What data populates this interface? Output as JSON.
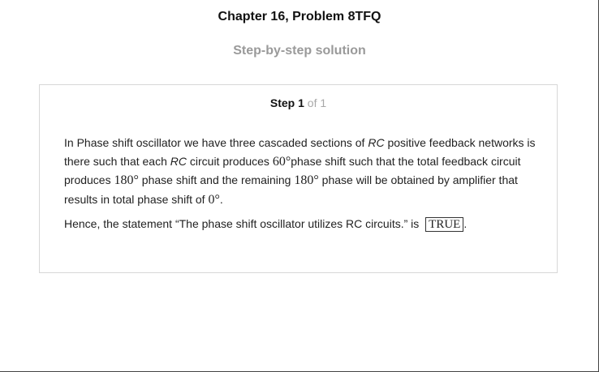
{
  "header": {
    "title": "Chapter 16, Problem 8TFQ",
    "subtitle": "Step-by-step solution"
  },
  "step": {
    "label": "Step",
    "number": "1",
    "of_text": "of 1"
  },
  "body": {
    "p1": {
      "t1": "In Phase shift oscillator we have three cascaded sections of ",
      "rc1": "RC",
      "t2": " positive feedback networks is there such that each ",
      "rc2": "RC",
      "t3": " circuit produces ",
      "m1": "60°",
      "t4": "phase shift such that the total feedback circuit produces ",
      "m2": "180°",
      "t5": " phase shift and the remaining ",
      "m3": "180°",
      "t6": " phase will be obtained by amplifier that results in total phase shift of ",
      "m4": "0°",
      "t7": "."
    },
    "p2": {
      "t1": "Hence, the statement “The phase shift oscillator utilizes RC circuits.” is ",
      "answer": "TRUE",
      "t2": "."
    }
  }
}
